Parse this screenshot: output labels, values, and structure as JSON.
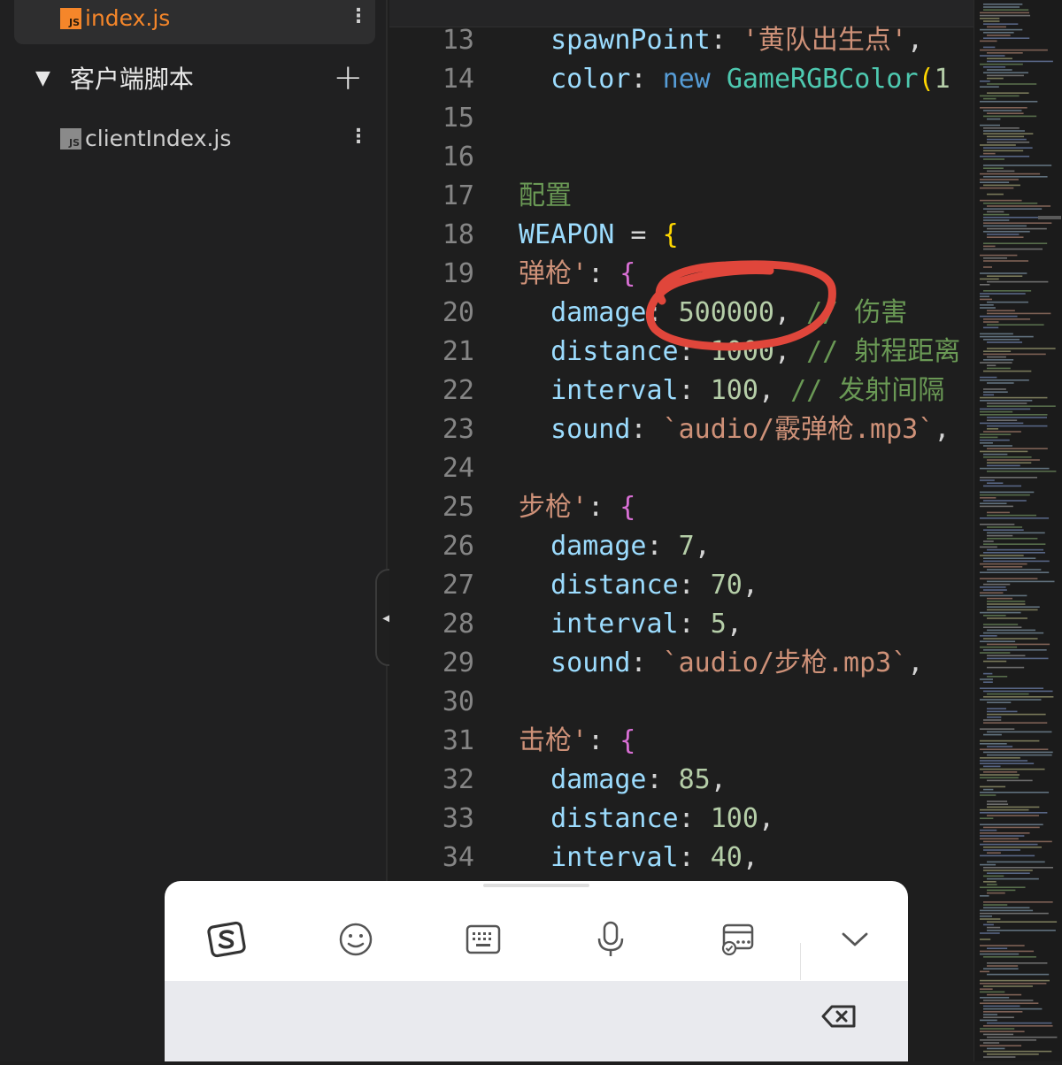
{
  "sidebar": {
    "active_file": {
      "name": "index.js",
      "badge": "JS",
      "menu_glyph": "⋮"
    },
    "folder": {
      "toggle_glyph": "▼",
      "label": "客户端脚本",
      "add_glyph": "+"
    },
    "child_file": {
      "name": "clientIndex.js",
      "badge": "JS",
      "menu_glyph": "⋮"
    },
    "collapse_glyph": "◀"
  },
  "editor": {
    "line_numbers": [
      "13",
      "14",
      "15",
      "16",
      "17",
      "18",
      "19",
      "20",
      "21",
      "22",
      "23",
      "24",
      "25",
      "26",
      "27",
      "28",
      "29",
      "30",
      "31",
      "32",
      "33",
      "34"
    ]
  },
  "ime": {
    "tools": [
      "sogou-logo-icon",
      "emoji-icon",
      "keyboard-icon",
      "microphone-icon",
      "clipboard-icon",
      "chevron-down-icon"
    ],
    "backspace_icon": "backspace-icon"
  },
  "colors": {
    "accent_orange": "#f5862a",
    "annotation_red": "#e0463b",
    "keyword": "#9cdcfe",
    "string": "#ce9178",
    "number": "#b5cea8",
    "comment": "#6a9955"
  }
}
